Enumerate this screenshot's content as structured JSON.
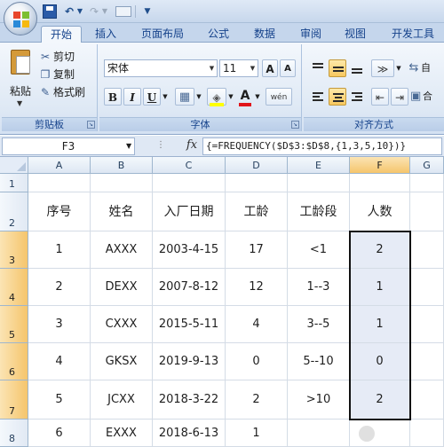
{
  "quick_access": {
    "undo": "↶",
    "redo": "↷",
    "dropdown": "▼",
    "customize": "▼"
  },
  "tabs": [
    {
      "label": "开始",
      "active": true
    },
    {
      "label": "插入"
    },
    {
      "label": "页面布局"
    },
    {
      "label": "公式"
    },
    {
      "label": "数据"
    },
    {
      "label": "审阅"
    },
    {
      "label": "视图"
    },
    {
      "label": "开发工具"
    }
  ],
  "ribbon": {
    "clipboard": {
      "title": "剪贴板",
      "paste": "粘贴",
      "cut": "剪切",
      "copy": "复制",
      "format_painter": "格式刷"
    },
    "font": {
      "title": "字体",
      "font_name": "宋体",
      "font_size": "11",
      "grow": "A",
      "shrink": "A",
      "bold": "B",
      "italic": "I",
      "underline": "U",
      "font_color_glyph": "A",
      "phonetic": "wén",
      "fill_color": "#ffff00",
      "font_color": "#e1141b"
    },
    "alignment": {
      "title": "对齐方式",
      "wrap_label": "自",
      "merge_label": "合"
    }
  },
  "formula_bar": {
    "cell_ref": "F3",
    "fx": "fx",
    "formula": "{=FREQUENCY($D$3:$D$8,{1,3,5,10})}"
  },
  "columns": [
    "A",
    "B",
    "C",
    "D",
    "E",
    "F",
    "G"
  ],
  "rows": [
    "1",
    "2",
    "3",
    "4",
    "5",
    "6",
    "7",
    "8"
  ],
  "headers": [
    "序号",
    "姓名",
    "入厂日期",
    "工龄",
    "工龄段",
    "人数"
  ],
  "data_rows": [
    [
      "1",
      "AXXX",
      "2003-4-15",
      "17",
      "<1",
      "2"
    ],
    [
      "2",
      "DEXX",
      "2007-8-12",
      "12",
      "1--3",
      "1"
    ],
    [
      "3",
      "CXXX",
      "2015-5-11",
      "4",
      "3--5",
      "1"
    ],
    [
      "4",
      "GKSX",
      "2019-9-13",
      "0",
      "5--10",
      "0"
    ],
    [
      "5",
      "JCXX",
      "2018-3-22",
      "2",
      ">10",
      "2"
    ],
    [
      "6",
      "EXXX",
      "2018-6-13",
      "1",
      "",
      ""
    ]
  ],
  "selection": {
    "active_column": "F",
    "range": "F3:F7"
  },
  "colors": {
    "selection_header": "#f5c56c",
    "selection_fill": "#e6ebf6",
    "ribbon_text": "#15428b"
  }
}
